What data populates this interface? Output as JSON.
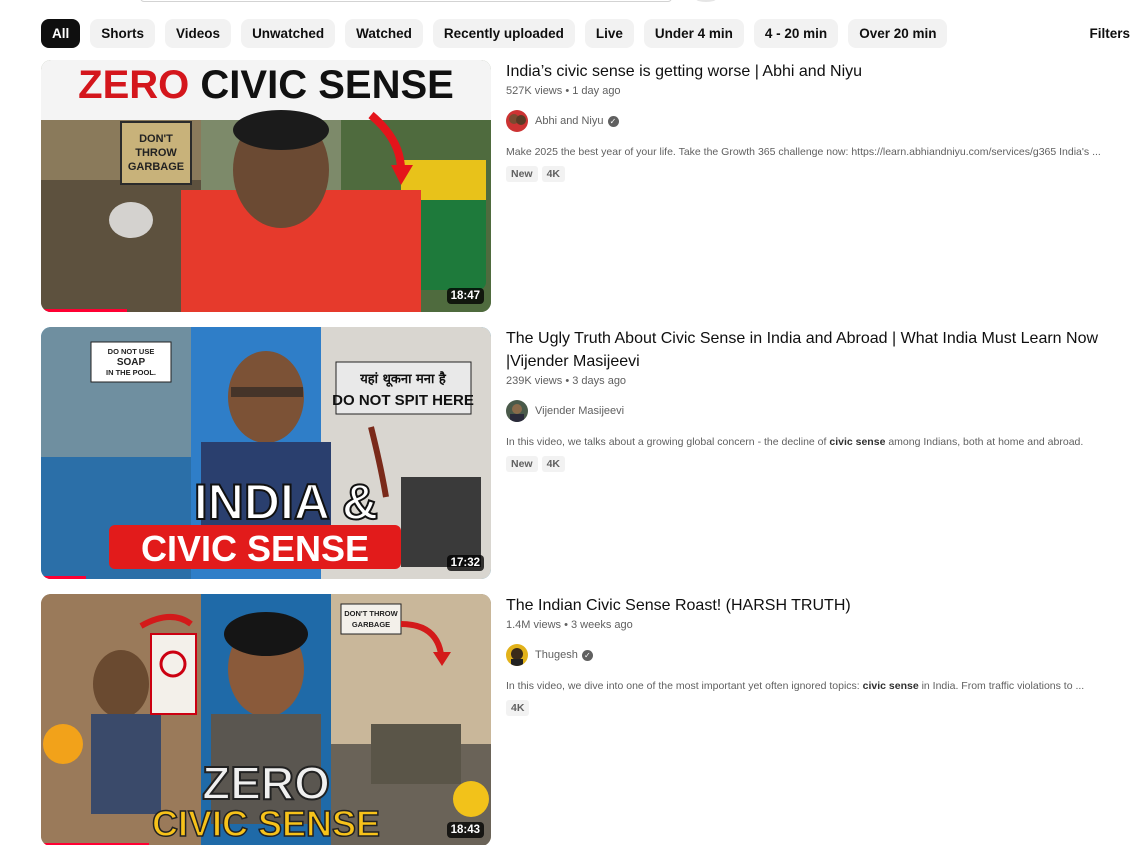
{
  "chips": [
    "All",
    "Shorts",
    "Videos",
    "Unwatched",
    "Watched",
    "Recently uploaded",
    "Live",
    "Under 4 min",
    "4 - 20 min",
    "Over 20 min"
  ],
  "filters_label": "Filters",
  "results": [
    {
      "title": "India’s civic sense is getting worse | Abhi and Niyu",
      "views": "527K views",
      "age": "1 day ago",
      "channel": "Abhi and Niyu",
      "verified": true,
      "description_before": "Make 2025 the best year of your life. Take the Growth 365 challenge now: https://learn.abhiandniyu.com/services/g365 India's ...",
      "description_bold": "",
      "description_after": "",
      "badges": [
        "New",
        "4K"
      ],
      "duration": "18:47",
      "progress": 0.19,
      "thumb_text": [
        "ZERO CIVIC SENSE",
        "DON'T THROW GARBAGE"
      ]
    },
    {
      "title": "The Ugly Truth About Civic Sense in India and Abroad | What India Must Learn Now |Vijender Masijeevi",
      "views": "239K views",
      "age": "3 days ago",
      "channel": "Vijender Masijeevi",
      "verified": false,
      "description_before": "In this video, we talks about a growing global concern - the decline of ",
      "description_bold": "civic sense",
      "description_after": " among Indians, both at home and abroad.",
      "badges": [
        "New",
        "4K"
      ],
      "duration": "17:32",
      "progress": 0.1,
      "thumb_text": [
        "INDIA &",
        "CIVIC SENSE",
        "DO NOT USE SOAP IN THE POOL",
        "यहां थूकना मना है",
        "DO NOT SPIT HERE"
      ]
    },
    {
      "title": "The Indian Civic Sense Roast! (HARSH TRUTH)",
      "views": "1.4M views",
      "age": "3 weeks ago",
      "channel": "Thugesh",
      "verified": true,
      "description_before": "In this video, we dive into one of the most important yet often ignored topics: ",
      "description_bold": "civic sense",
      "description_after": " in India. From traffic violations to ...",
      "badges": [
        "4K"
      ],
      "duration": "18:43",
      "progress": 0.24,
      "thumb_text": [
        "ZERO",
        "CIVIC SENSE",
        "DON'T THROW GARBAGE"
      ]
    }
  ],
  "colors": {
    "accent_red": "#ff0033",
    "chip_bg": "#f2f2f2",
    "chip_active_bg": "#0f0f0f",
    "meta_text": "#606060"
  }
}
